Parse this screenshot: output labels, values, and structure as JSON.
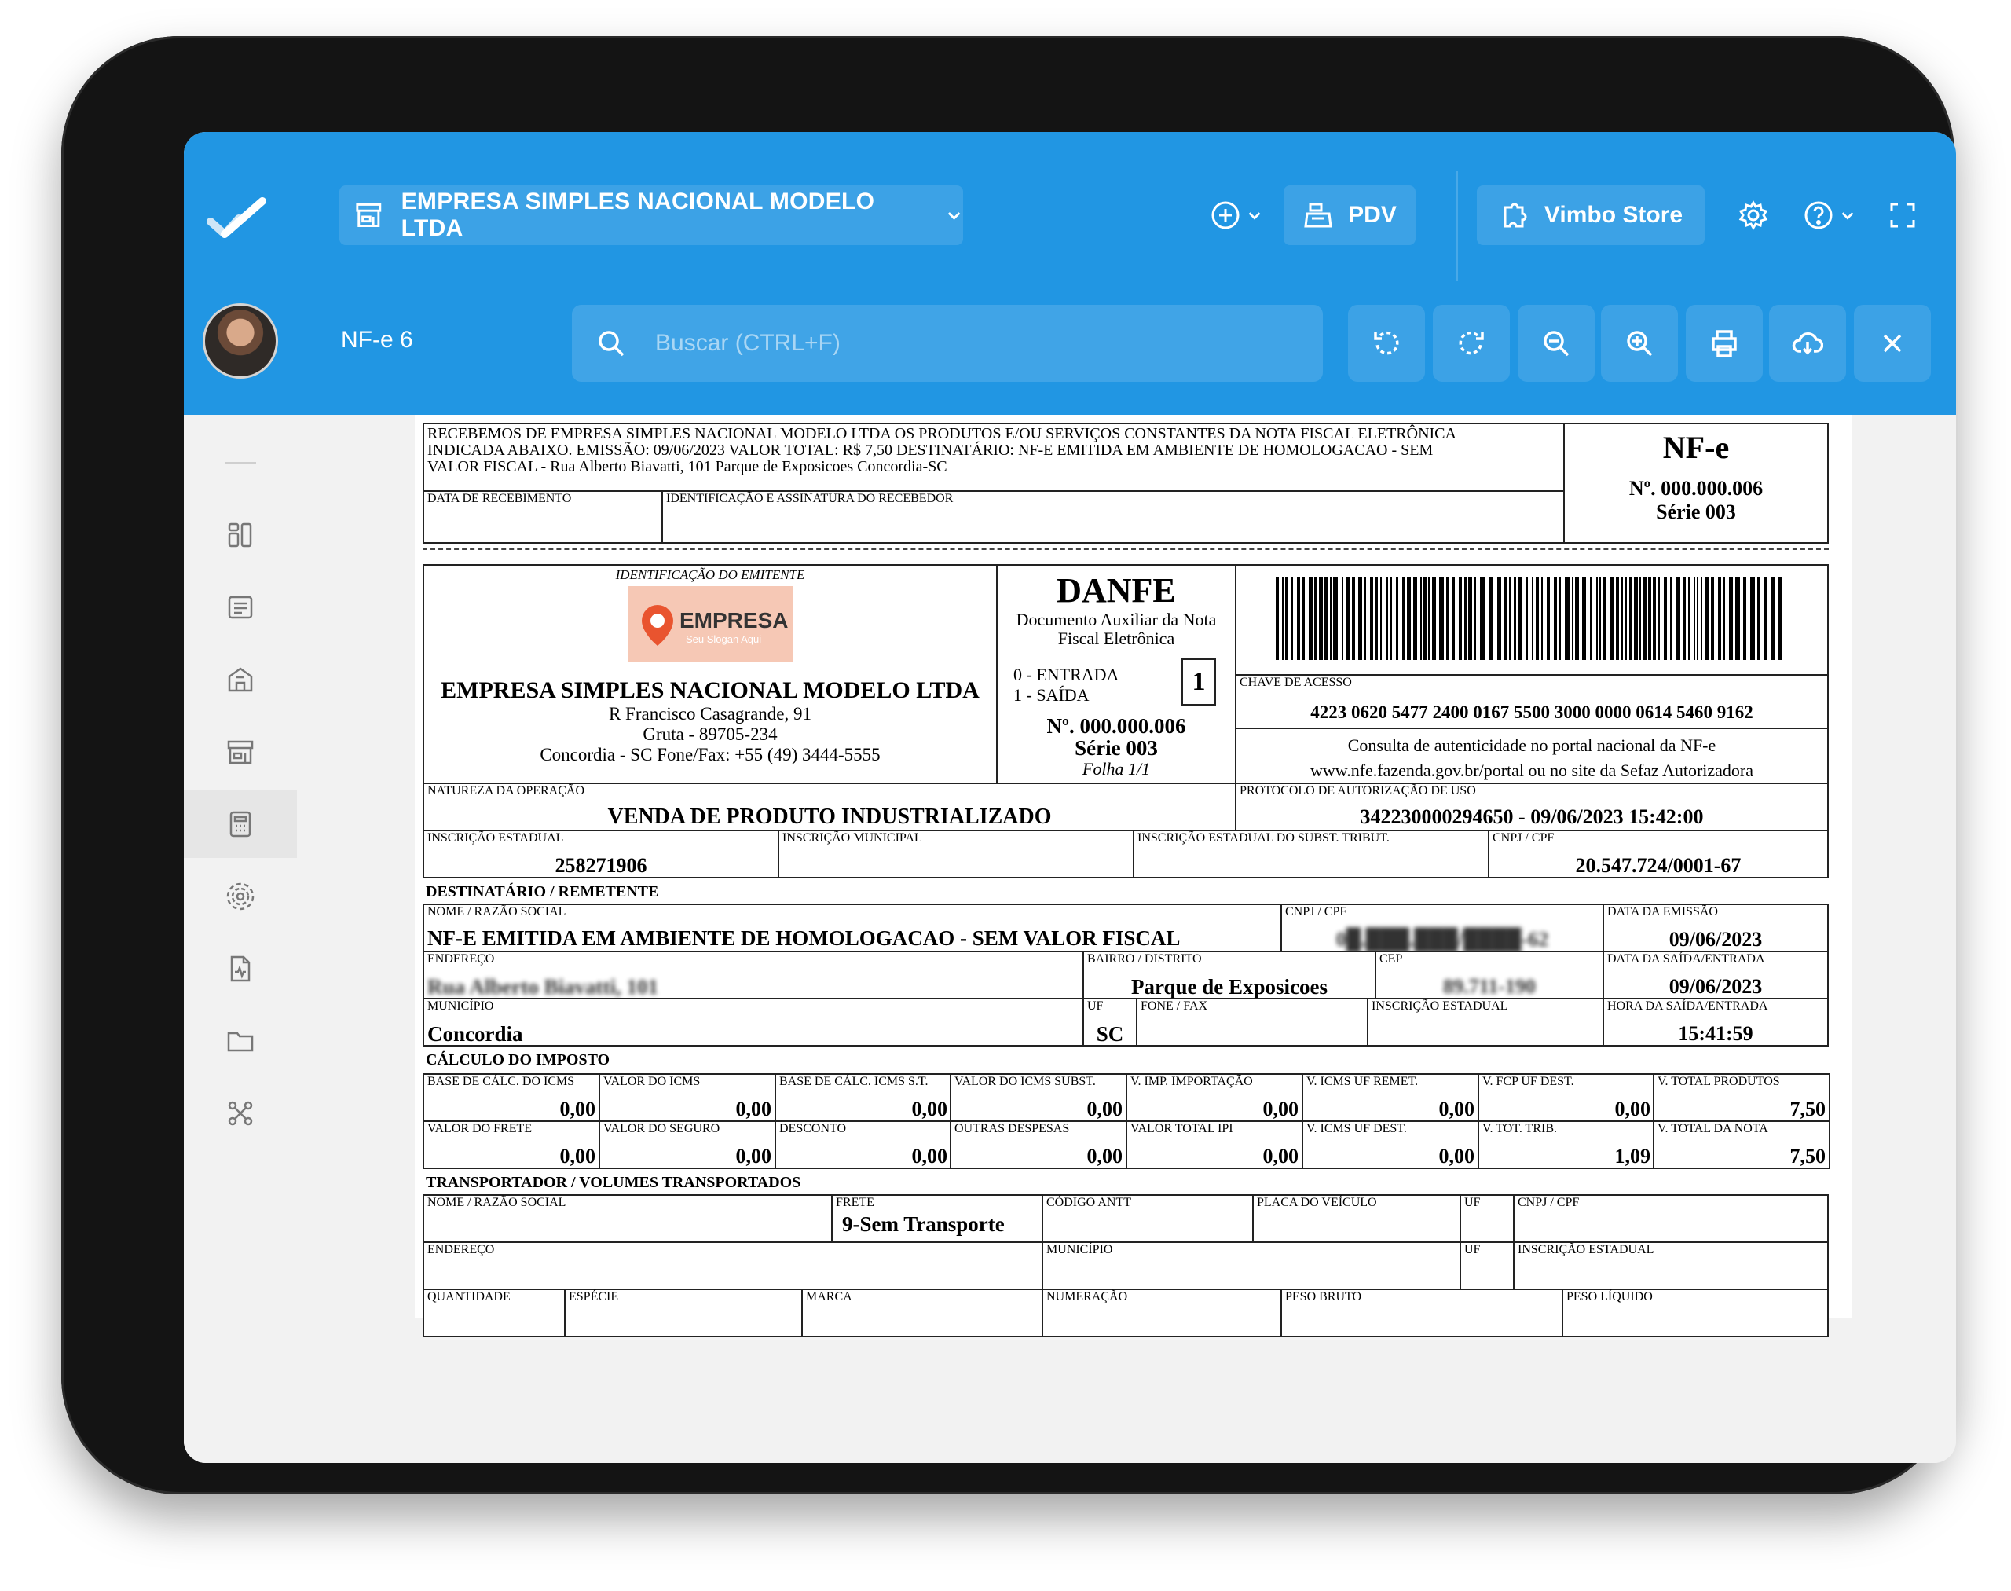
{
  "header": {
    "company": "EMPRESA SIMPLES NACIONAL MODELO LTDA",
    "pdv_label": "PDV",
    "store_label": "Vimbo Store",
    "tab_title": "NF-e 6",
    "search_placeholder": "Buscar (CTRL+F)"
  },
  "colors": {
    "header_bg": "#2196e3",
    "frame": "#141414",
    "content_bg": "#f2f2f2"
  },
  "doc": {
    "receipt_text": [
      "RECEBEMOS DE EMPRESA SIMPLES NACIONAL MODELO LTDA OS PRODUTOS E/OU SERVIÇOS CONSTANTES DA NOTA FISCAL ELETRÔNICA",
      "INDICADA ABAIXO. EMISSÃO: 09/06/2023 VALOR TOTAL: R$ 7,50 DESTINATÁRIO: NF-E EMITIDA EM AMBIENTE DE HOMOLOGACAO - SEM",
      "VALOR FISCAL - Rua Alberto Biavatti, 101 Parque de Exposicoes Concordia-SC"
    ],
    "data_recebimento_label": "DATA DE RECEBIMENTO",
    "identificacao_label": "IDENTIFICAÇÃO E ASSINATURA DO RECEBEDOR",
    "nfe_title": "NF-e",
    "nfe_number": "Nº. 000.000.006",
    "nfe_serie": "Série 003",
    "emitente_label": "IDENTIFICAÇÃO DO EMITENTE",
    "logo_text": "EMPRESA",
    "logo_slogan": "Seu Slogan Aqui",
    "emitente_name": "EMPRESA SIMPLES NACIONAL MODELO LTDA",
    "emitente_addr1": "R Francisco Casagrande, 91",
    "emitente_addr2": "Gruta - 89705-234",
    "emitente_addr3": "Concordia - SC Fone/Fax: +55 (49) 3444-5555",
    "danfe_title": "DANFE",
    "danfe_sub1": "Documento Auxiliar da Nota",
    "danfe_sub2": "Fiscal Eletrônica",
    "entrada": "0 - ENTRADA",
    "saida": "1 - SAÍDA",
    "tipo": "1",
    "danfe_number": "Nº. 000.000.006",
    "danfe_serie": "Série 003",
    "folha": "Folha 1/1",
    "chave_label": "CHAVE DE ACESSO",
    "chave": "4223 0620 5477 2400 0167 5500 3000 0000 0614 5460 9162",
    "consulta1": "Consulta de autenticidade no portal nacional da NF-e",
    "consulta2": "www.nfe.fazenda.gov.br/portal ou no site da Sefaz Autorizadora",
    "natureza_label": "NATUREZA DA OPERAÇÃO",
    "natureza": "VENDA DE PRODUTO INDUSTRIALIZADO",
    "protocolo_label": "PROTOCOLO DE AUTORIZAÇÃO DE USO",
    "protocolo": "342230000294650  -  09/06/2023 15:42:00",
    "ie_label": "INSCRIÇÃO ESTADUAL",
    "ie": "258271906",
    "im_label": "INSCRIÇÃO MUNICIPAL",
    "iest_label": "INSCRIÇÃO ESTADUAL DO SUBST. TRIBUT.",
    "cnpj_label": "CNPJ / CPF",
    "cnpj": "20.547.724/0001-67",
    "dest_section": "DESTINATÁRIO / REMETENTE",
    "dest_nome_label": "NOME / RAZÃO SOCIAL",
    "dest_nome": "NF-E EMITIDA EM AMBIENTE DE HOMOLOGACAO - SEM VALOR FISCAL",
    "dest_cnpj_label": "CNPJ / CPF",
    "dest_cnpj": "0█.███.███/████-62",
    "data_emissao_label": "DATA DA EMISSÃO",
    "data_emissao": "09/06/2023",
    "endereco_label": "ENDEREÇO",
    "endereco": "Rua Alberto Biavatti, 101",
    "bairro_label": "BAIRRO / DISTRITO",
    "bairro": "Parque de Exposicoes",
    "cep_label": "CEP",
    "cep": "89.711-190",
    "data_saida_label": "DATA DA SAÍDA/ENTRADA",
    "data_saida": "09/06/2023",
    "municipio_label": "MUNICÍPIO",
    "municipio": "Concordia",
    "uf_label": "UF",
    "uf": "SC",
    "fone_label": "FONE / FAX",
    "dest_ie_label": "INSCRIÇÃO ESTADUAL",
    "hora_label": "HORA DA SAÍDA/ENTRADA",
    "hora": "15:41:59",
    "calc_section": "CÁLCULO DO IMPOSTO",
    "tax_row1": [
      {
        "label": "BASE DE CÁLC. DO ICMS",
        "value": "0,00"
      },
      {
        "label": "VALOR DO ICMS",
        "value": "0,00"
      },
      {
        "label": "BASE DE CÁLC. ICMS S.T.",
        "value": "0,00"
      },
      {
        "label": "VALOR DO ICMS SUBST.",
        "value": "0,00"
      },
      {
        "label": "V. IMP. IMPORTAÇÃO",
        "value": "0,00"
      },
      {
        "label": "V. ICMS UF REMET.",
        "value": "0,00"
      },
      {
        "label": "V. FCP UF DEST.",
        "value": "0,00"
      },
      {
        "label": "V. TOTAL PRODUTOS",
        "value": "7,50"
      }
    ],
    "tax_row2": [
      {
        "label": "VALOR DO FRETE",
        "value": "0,00"
      },
      {
        "label": "VALOR DO SEGURO",
        "value": "0,00"
      },
      {
        "label": "DESCONTO",
        "value": "0,00"
      },
      {
        "label": "OUTRAS DESPESAS",
        "value": "0,00"
      },
      {
        "label": "VALOR TOTAL IPI",
        "value": "0,00"
      },
      {
        "label": "V. ICMS UF DEST.",
        "value": "0,00"
      },
      {
        "label": "V. TOT. TRIB.",
        "value": "1,09"
      },
      {
        "label": "V. TOTAL DA NOTA",
        "value": "7,50"
      }
    ],
    "transp_section": "TRANSPORTADOR / VOLUMES TRANSPORTADOS",
    "t_nome_label": "NOME / RAZÃO SOCIAL",
    "frete_label": "FRETE",
    "frete": "9-Sem Transporte",
    "antt_label": "CÓDIGO ANTT",
    "placa_label": "PLACA DO VEÍCULO",
    "t_uf_label": "UF",
    "t_cnpj_label": "CNPJ / CPF",
    "t_end_label": "ENDEREÇO",
    "t_mun_label": "MUNICÍPIO",
    "t_uf2_label": "UF",
    "t_ie_label": "INSCRIÇÃO ESTADUAL",
    "qtd_label": "QUANTIDADE",
    "especie_label": "ESPÉCIE",
    "marca_label": "MARCA",
    "numeracao_label": "NUMERAÇÃO",
    "bruto_label": "PESO BRUTO",
    "liquido_label": "PESO LÍQUIDO"
  }
}
